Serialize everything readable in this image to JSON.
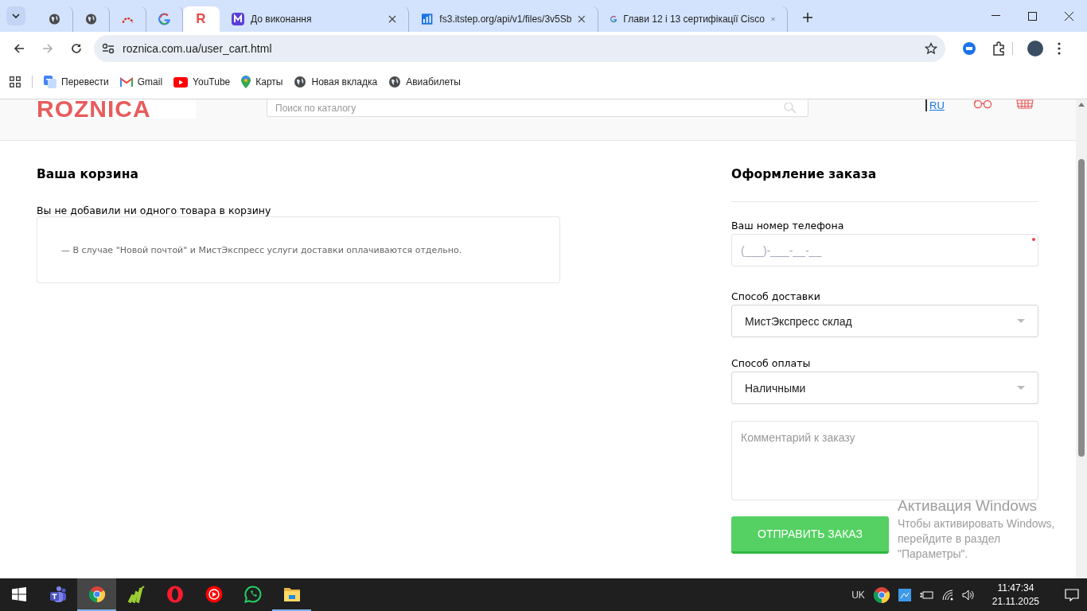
{
  "browser": {
    "tabs": [
      {
        "kind": "pinned",
        "selected": false
      },
      {
        "kind": "pinned",
        "selected": false
      },
      {
        "kind": "pinned",
        "selected": false
      },
      {
        "kind": "pinned",
        "selected": false
      },
      {
        "kind": "pinned",
        "favicon_letter": "R",
        "selected": true
      },
      {
        "kind": "titled",
        "title": "До виконання",
        "selected": false
      },
      {
        "kind": "titled",
        "title": "fs3.itstep.org/api/v1/files/3v5Sb",
        "selected": false
      },
      {
        "kind": "titled",
        "title": "Глави 12 і 13 сертифікації Cisco",
        "selected": false
      }
    ],
    "url": "roznica.com.ua/user_cart.html",
    "bookmarks": [
      "Перевести",
      "Gmail",
      "YouTube",
      "Карты",
      "Новая вкладка",
      "Авиабилеты"
    ]
  },
  "site_header": {
    "logo": "ROZNICA",
    "search": {
      "placeholder": "Поиск по каталогу"
    },
    "language": "RU"
  },
  "cart": {
    "title": "Ваша корзина",
    "empty_message": "Вы не добавили ни одного товара в корзину",
    "note": "— В случае \"Новой почтой\" и МистЭкспресс услуги доставки оплачиваются отдельно."
  },
  "checkout": {
    "title": "Оформление заказа",
    "phone": {
      "label": "Ваш номер телефона",
      "placeholder": "(___)-___-__-__",
      "required": true
    },
    "delivery": {
      "label": "Способ доставки",
      "value": "МистЭкспресс склад"
    },
    "payment": {
      "label": "Способ оплаты",
      "value": "Наличными"
    },
    "comment": {
      "placeholder": "Комментарий к заказу"
    },
    "submit": "ОТПРАВИТЬ ЗАКАЗ"
  },
  "activation_notice": {
    "title": "Активация Windows",
    "text": "Чтобы активировать Windows, перейдите в раздел \"Параметры\"."
  },
  "taskbar": {
    "apps": [
      {
        "running": false,
        "selected": false
      },
      {
        "running": true,
        "selected": true
      },
      {
        "running": false,
        "selected": false
      },
      {
        "running": false,
        "selected": false
      },
      {
        "running": false,
        "selected": false
      },
      {
        "running": false,
        "selected": false
      },
      {
        "running": true,
        "selected": false
      }
    ],
    "language": "UK",
    "time": "11:47:34",
    "date": "21.11.2025"
  }
}
